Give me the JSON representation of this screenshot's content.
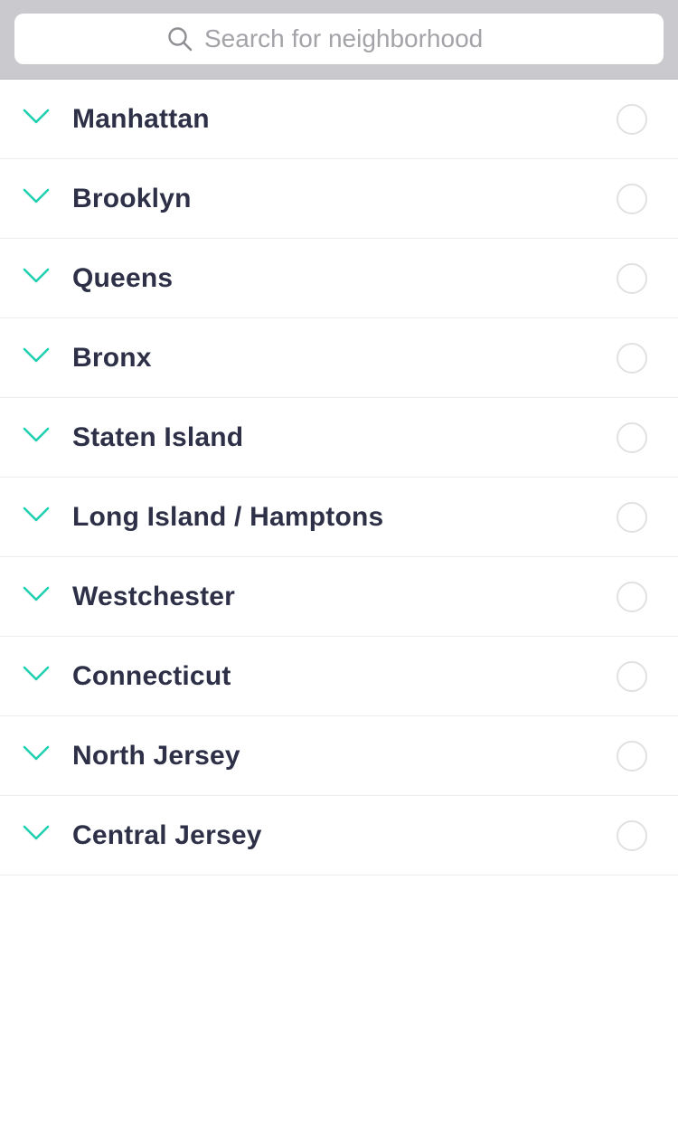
{
  "search": {
    "placeholder": "Search for neighborhood",
    "icon": "search-icon"
  },
  "colors": {
    "accent": "#1fcfb0",
    "text": "#2d3047",
    "header_bg": "#c9c9ce",
    "divider": "#ececee"
  },
  "regions": [
    {
      "label": "Manhattan",
      "selected": false
    },
    {
      "label": "Brooklyn",
      "selected": false
    },
    {
      "label": "Queens",
      "selected": false
    },
    {
      "label": "Bronx",
      "selected": false
    },
    {
      "label": "Staten Island",
      "selected": false
    },
    {
      "label": "Long Island / Hamptons",
      "selected": false
    },
    {
      "label": "Westchester",
      "selected": false
    },
    {
      "label": "Connecticut",
      "selected": false
    },
    {
      "label": "North Jersey",
      "selected": false
    },
    {
      "label": "Central Jersey",
      "selected": false
    }
  ]
}
